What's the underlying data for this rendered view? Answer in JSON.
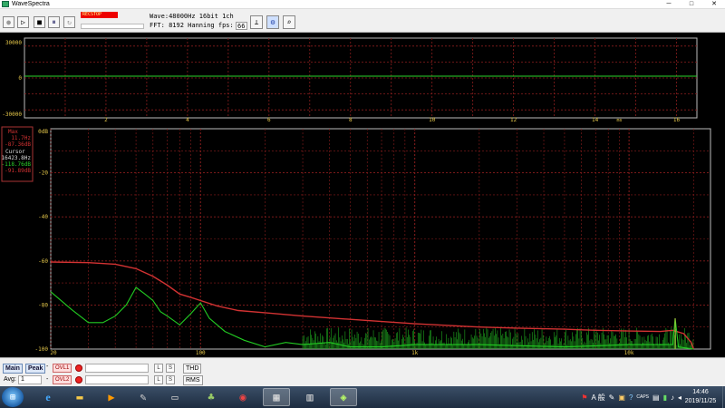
{
  "window": {
    "title": "WaveSpectra",
    "minimize": "─",
    "maximize": "□",
    "close": "✕"
  },
  "toolbar": {
    "buttons": [
      {
        "name": "record-button",
        "glyph": "●"
      },
      {
        "name": "play-button",
        "glyph": "▷"
      },
      {
        "name": "stop-button",
        "glyph": "■"
      },
      {
        "name": "pause-button",
        "glyph": "⏸"
      },
      {
        "name": "loop-button",
        "glyph": "↻"
      }
    ],
    "stop_indicator": "RECSTOP",
    "wave_info": "Wave:48000Hz 16bit 1ch",
    "fft_info": "FFT: 8192 Hanning",
    "fps_label": "fps:",
    "fps_value": "66"
  },
  "wave_plot": {
    "y_ticks": [
      "30000",
      "0",
      "-30000"
    ],
    "x_ticks": [
      "2",
      "4",
      "6",
      "8",
      "10",
      "12",
      "14",
      "16"
    ],
    "x_unit": "ms"
  },
  "spectrum_plot": {
    "y_ticks": [
      "0dB",
      "-20",
      "-40",
      "-60",
      "-80",
      "-100"
    ],
    "x_ticks": [
      "20",
      "100",
      "1k",
      "10k"
    ],
    "readout": {
      "max_label": "Max",
      "max_freq": "11.7Hz",
      "max_level": "-87.36dB",
      "cursor_label": "Cursor",
      "cursor_freq": "16423.8Hz",
      "cursor_level1": "-118.76dB",
      "cursor_level2": "-91.89dB"
    }
  },
  "chart_data": {
    "type": "line",
    "xlim_hz": [
      20,
      24000
    ],
    "ylim_db": [
      -100,
      0
    ],
    "log_x": true,
    "grid": true,
    "series": [
      {
        "color": "#d23232",
        "x": [
          20,
          30,
          40,
          50,
          60,
          70,
          80,
          90,
          100,
          120,
          150,
          200,
          300,
          500,
          700,
          1000,
          2000,
          3000,
          5000,
          7000,
          10000,
          14000,
          16000,
          18000,
          19500,
          20000
        ],
        "y": [
          -60.5,
          -60.8,
          -61.5,
          -63.5,
          -67,
          -71,
          -75,
          -76.5,
          -78,
          -80.5,
          -82.5,
          -83.5,
          -85,
          -86.5,
          -87.5,
          -88.5,
          -90,
          -90.5,
          -91,
          -91.5,
          -91.8,
          -92,
          -91.5,
          -93,
          -97,
          -100
        ]
      },
      {
        "color": "#22cc22",
        "x": [
          20,
          25,
          30,
          35,
          40,
          45,
          50,
          55,
          60,
          65,
          70,
          80,
          90,
          100,
          110,
          130,
          160,
          200,
          250,
          300,
          400,
          500,
          700,
          1000,
          2000,
          5000,
          10000,
          16000,
          16423,
          17000,
          20000
        ],
        "y": [
          -74,
          -82,
          -88,
          -88,
          -85,
          -80,
          -72,
          -75,
          -78,
          -83,
          -85,
          -89,
          -84,
          -79,
          -86,
          -92,
          -96,
          -99,
          -97,
          -98,
          -97,
          -99,
          -99,
          -98,
          -98,
          -99,
          -98,
          -98,
          -86,
          -99,
          -100
        ]
      }
    ]
  },
  "statusbar": {
    "main_button": "Main",
    "peak_button": "Peak",
    "ovl1": "OVL1",
    "ovl2": "OVL2",
    "avg_label": "Avg:",
    "avg_value": "1",
    "l_label": "L",
    "s_label": "S",
    "thd_button": "THD",
    "rms_button": "RMS"
  },
  "taskbar": {
    "ime": "A 般",
    "caps": "CAPS",
    "time": "14:46",
    "date": "2019/11/25"
  }
}
